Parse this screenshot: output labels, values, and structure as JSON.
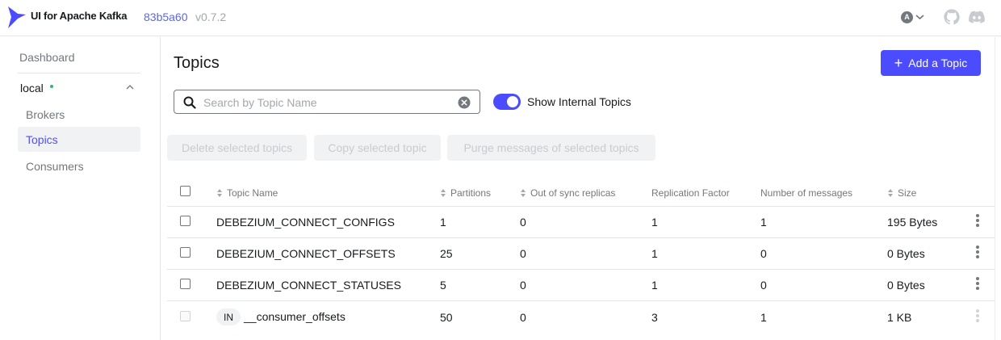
{
  "navbar": {
    "app_title": "UI for Apache Kafka",
    "version_hash": "83b5a60",
    "version_number": "v0.7.2",
    "user_initial": "A",
    "brand_color": "#4c4cff",
    "icons": [
      "logo-icon",
      "chevron-down-icon",
      "github-icon",
      "discord-icon"
    ]
  },
  "sidebar": {
    "dashboard": "Dashboard",
    "cluster": {
      "name": "local",
      "status_color": "#2eb86b",
      "expanded": true
    },
    "items": [
      {
        "label": "Brokers",
        "active": false
      },
      {
        "label": "Topics",
        "active": true
      },
      {
        "label": "Consumers",
        "active": false
      }
    ]
  },
  "main": {
    "title": "Topics",
    "add_button": "Add a Topic",
    "search": {
      "placeholder": "Search by Topic Name",
      "value": ""
    },
    "show_internal": {
      "label": "Show Internal Topics",
      "enabled": true
    },
    "bulk_actions": [
      "Delete selected topics",
      "Copy selected topic",
      "Purge messages of selected topics"
    ]
  },
  "table": {
    "columns": [
      "Topic Name",
      "Partitions",
      "Out of sync replicas",
      "Replication Factor",
      "Number of messages",
      "Size"
    ],
    "rows": [
      {
        "name": "DEBEZIUM_CONNECT_CONFIGS",
        "internal": false,
        "partitions": "1",
        "out_of_sync": "0",
        "replication": "1",
        "messages": "1",
        "size": "195 Bytes"
      },
      {
        "name": "DEBEZIUM_CONNECT_OFFSETS",
        "internal": false,
        "partitions": "25",
        "out_of_sync": "0",
        "replication": "1",
        "messages": "0",
        "size": "0 Bytes"
      },
      {
        "name": "DEBEZIUM_CONNECT_STATUSES",
        "internal": false,
        "partitions": "5",
        "out_of_sync": "0",
        "replication": "1",
        "messages": "0",
        "size": "0 Bytes"
      },
      {
        "name": "__consumer_offsets",
        "internal": true,
        "badge": "IN",
        "partitions": "50",
        "out_of_sync": "0",
        "replication": "3",
        "messages": "1",
        "size": "1 KB"
      }
    ]
  }
}
